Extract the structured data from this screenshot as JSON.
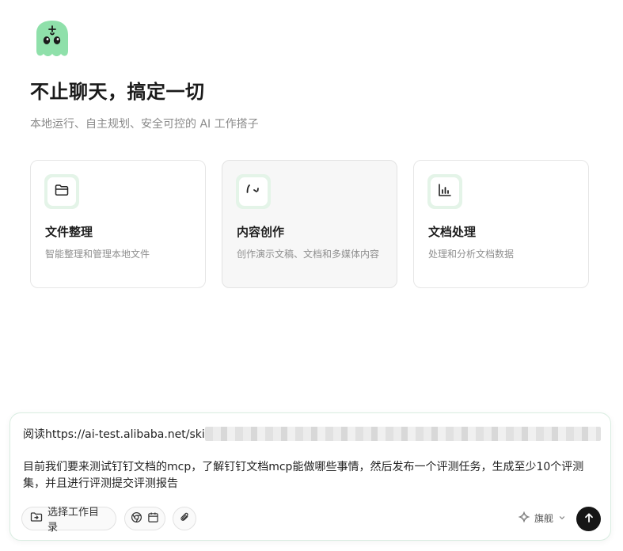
{
  "app": {
    "logo_name": "mascot-logo",
    "accent_color": "#7dd79b"
  },
  "hero": {
    "title": "不止聊天，搞定一切",
    "subtitle": "本地运行、自主规划、安全可控的 AI 工作搭子"
  },
  "cards": [
    {
      "icon": "folder-icon",
      "title": "文件整理",
      "description": "智能整理和管理本地文件"
    },
    {
      "icon": "quote-icon",
      "title": "内容创作",
      "description": "创作演示文稿、文档和多媒体内容"
    },
    {
      "icon": "bar-chart-icon",
      "title": "文档处理",
      "description": "处理和分析文档数据"
    }
  ],
  "composer": {
    "line1": "阅读https://ai-test.alibaba.net/ski",
    "body": "目前我们要来测试钉钉文档的mcp，了解钉钉文档mcp能做哪些事情，然后发布一个评测任务，生成至少10个评测集，并且进行评测提交评测报告",
    "select_folder_label": "选择工作目录",
    "model_label": "旗舰",
    "colors": {
      "border": "#d9ede1",
      "send_button": "#161616"
    }
  }
}
